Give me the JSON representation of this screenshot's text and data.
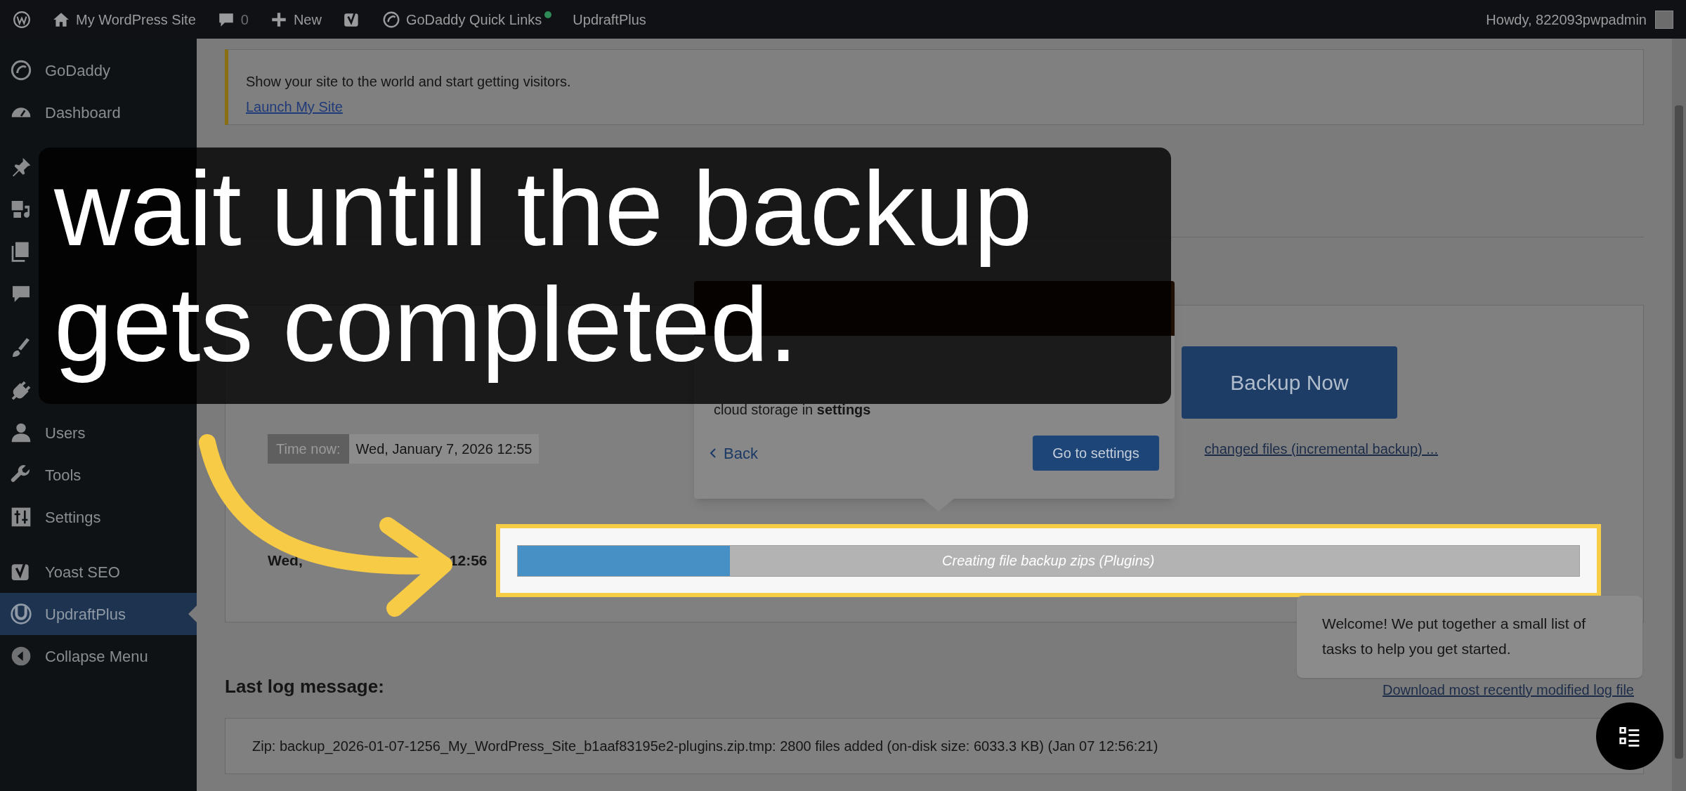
{
  "admin_bar": {
    "items": [
      {
        "kind": "wp"
      },
      {
        "kind": "home",
        "label": "My WordPress Site"
      },
      {
        "kind": "comments",
        "label": "0"
      },
      {
        "kind": "new",
        "label": "New"
      },
      {
        "kind": "yoast"
      },
      {
        "kind": "godaddy",
        "label": "GoDaddy Quick Links"
      },
      {
        "kind": "text",
        "label": "UpdraftPlus"
      }
    ],
    "account": "Howdy, 822093pwpadmin"
  },
  "sidebar": {
    "groups": [
      [
        {
          "kind": "godaddy",
          "label": "GoDaddy",
          "selected": false
        },
        {
          "kind": "dashboard",
          "label": "Dashboard",
          "selected": false
        }
      ],
      [
        {
          "kind": "pin",
          "selected": false
        },
        {
          "kind": "media",
          "selected": false
        },
        {
          "kind": "pages",
          "selected": false
        },
        {
          "kind": "comments",
          "selected": false
        }
      ],
      [
        {
          "kind": "brush",
          "selected": false
        },
        {
          "kind": "plug",
          "selected": false
        },
        {
          "kind": "user",
          "label": "Users",
          "selected": false
        },
        {
          "kind": "wrench",
          "label": "Tools",
          "selected": false
        },
        {
          "kind": "sliders",
          "label": "Settings",
          "selected": false
        }
      ],
      [
        {
          "kind": "yoast",
          "label": "Yoast SEO",
          "selected": false
        },
        {
          "kind": "updraft",
          "label": "UpdraftPlus",
          "selected": true
        },
        {
          "kind": "collapse",
          "label": "Collapse Menu",
          "selected": false
        }
      ]
    ]
  },
  "notice": {
    "text": "Show your site to the world and start getting visitors.",
    "link": "Launch My Site"
  },
  "backup_button": "Backup Now",
  "time_now": {
    "label": "Time now:",
    "value": "Wed, January 7, 2026 12:55"
  },
  "incremental_link": "changed files (incremental backup) ...",
  "running": {
    "date_parts": [
      "Wed,",
      "12:56"
    ],
    "progress": {
      "level": 0.2,
      "label": "Creating file backup zips (Plugins)"
    }
  },
  "popup": {
    "body": [
      "cloud storage in **settings**"
    ],
    "back": "Back",
    "button": "Go to settings"
  },
  "tooltip": "Welcome! We put together a small list of tasks to help you get started.",
  "log": {
    "heading": "Last log message:",
    "download": "Download most recently modified log file",
    "message": "Zip: backup_2026-01-07-1256_My_WordPress_Site_b1aaf83195e2-plugins.zip.tmp: 2800 files added (on-disk size: 6033.3 KB) (Jan 07 12:56:21)"
  },
  "caption": [
    "wait untill the backup",
    "gets completed."
  ]
}
